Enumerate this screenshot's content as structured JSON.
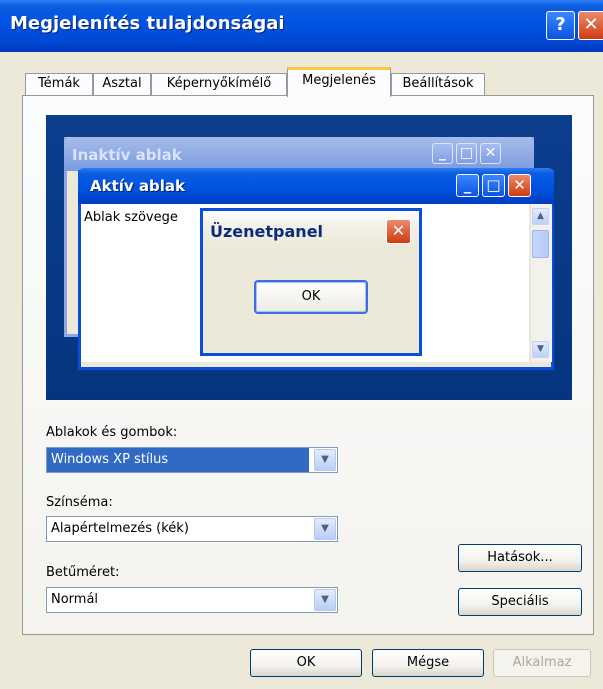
{
  "window": {
    "title": "Megjelenítés tulajdonságai",
    "help_glyph": "?",
    "close_glyph": "✕"
  },
  "tabs": [
    "Témák",
    "Asztal",
    "Képernyőkímélő",
    "Megjelenés",
    "Beállítások"
  ],
  "active_tab_index": 3,
  "preview": {
    "inactive_title": "Inaktív ablak",
    "active_title": "Aktív ablak",
    "window_text": "Ablak szövege",
    "message_title": "Üzenetpanel",
    "message_ok": "OK",
    "min_glyph": "_",
    "max_glyph": "□",
    "close_glyph": "✕",
    "scroll_up": "▲",
    "scroll_down": "▼"
  },
  "form": {
    "windows_buttons_label": "Ablakok és gombok:",
    "windows_buttons_value": "Windows XP stílus",
    "color_scheme_label": "Színséma:",
    "color_scheme_value": "Alapértelmezés (kék)",
    "font_size_label": "Betűméret:",
    "font_size_value": "Normál",
    "dropdown_glyph": "▼",
    "effects_button": "Hatások...",
    "advanced_button": "Speciális"
  },
  "footer": {
    "ok": "OK",
    "cancel": "Mégse",
    "apply": "Alkalmaz"
  },
  "colors": {
    "titlebar": "#0054e3",
    "dialog_bg": "#ece9d8",
    "preview_bg": "#0a3d8f",
    "selection": "#316ac5",
    "tab_highlight": "#ffc83c"
  }
}
